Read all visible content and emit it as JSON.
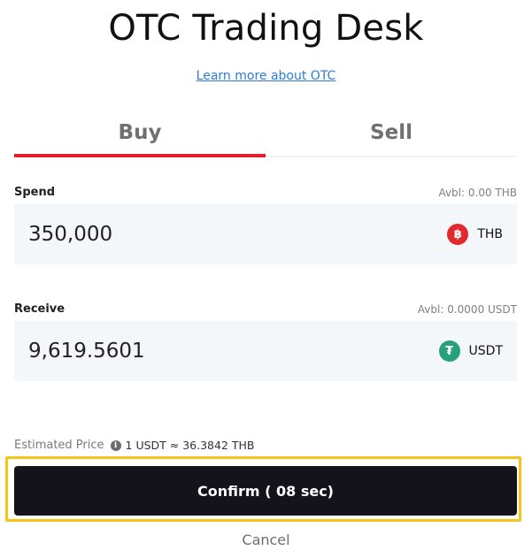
{
  "header": {
    "title": "OTC Trading Desk",
    "learn_link": "Learn more about OTC"
  },
  "tabs": [
    {
      "label": "Buy",
      "active": true
    },
    {
      "label": "Sell",
      "active": false
    }
  ],
  "spend": {
    "label": "Spend",
    "available": "Avbl: 0.00 THB",
    "value": "350,000",
    "currency_code": "THB",
    "currency_icon_glyph": "฿",
    "icon": "thb-coin-icon",
    "icon_color": "#e02a2e"
  },
  "receive": {
    "label": "Receive",
    "available": "Avbl: 0.0000 USDT",
    "value": "9,619.5601",
    "currency_code": "USDT",
    "currency_icon_glyph": "₮",
    "icon": "usdt-coin-icon",
    "icon_color": "#26a17b"
  },
  "estimate": {
    "label": "Estimated Price",
    "info_glyph": "i",
    "value": "1 USDT ≈ 36.3842 THB"
  },
  "actions": {
    "confirm_label": "Confirm ( 08 sec)",
    "cancel_label": "Cancel"
  },
  "colors": {
    "accent": "#e2202b",
    "button_bg": "#14121a",
    "highlight": "#f5c518",
    "link": "#2f7bd6"
  }
}
